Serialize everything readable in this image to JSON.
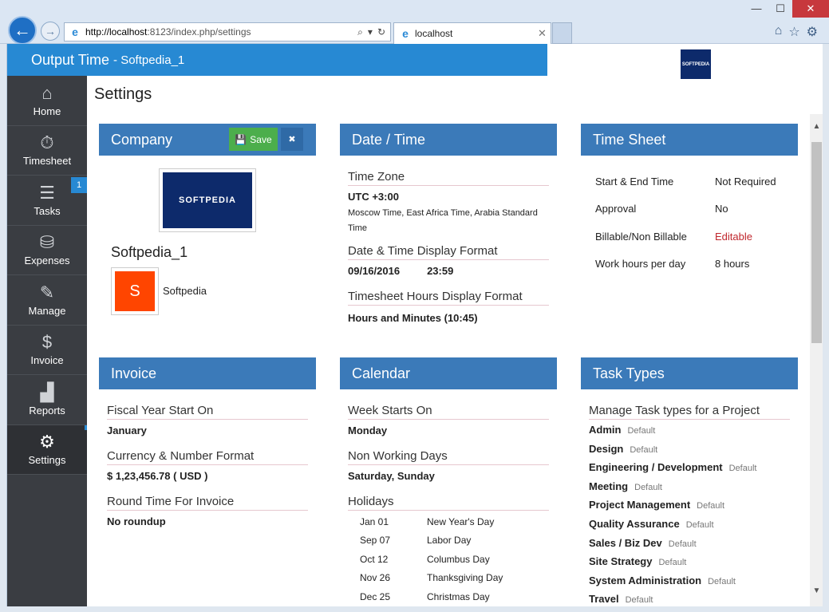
{
  "browser": {
    "url_host": "http://localhost",
    "url_rest": ":8123/index.php/settings",
    "tab_title": "localhost",
    "win_min": "—",
    "win_max": "☐",
    "win_close": "✕"
  },
  "app": {
    "title": "Output Time",
    "subtitle": "- Softpedia_1",
    "header_logo_text": "SOFTPEDIA"
  },
  "sidebar": {
    "items": [
      {
        "label": "Home",
        "icon": "home-icon"
      },
      {
        "label": "Timesheet",
        "icon": "stopwatch-icon"
      },
      {
        "label": "Tasks",
        "icon": "tasks-icon",
        "badge": "1"
      },
      {
        "label": "Expenses",
        "icon": "coins-icon"
      },
      {
        "label": "Manage",
        "icon": "edit-icon"
      },
      {
        "label": "Invoice",
        "icon": "invoice-icon"
      },
      {
        "label": "Reports",
        "icon": "chart-icon"
      },
      {
        "label": "Settings",
        "icon": "gear-icon"
      }
    ]
  },
  "page": {
    "title": "Settings"
  },
  "company": {
    "heading": "Company",
    "save_label": "Save",
    "logo_text": "SOFTPEDIA",
    "name": "Softpedia_1",
    "avatar_initial": "S",
    "avatar_label": "Softpedia"
  },
  "datetime": {
    "heading": "Date / Time",
    "tz_label": "Time Zone",
    "tz_value": "UTC +3:00",
    "tz_note": "Moscow Time, East Africa Time, Arabia Standard Time",
    "format_label": "Date & Time Display Format",
    "date_value": "09/16/2016",
    "time_value": "23:59",
    "hours_label": "Timesheet Hours Display Format",
    "hours_value": "Hours and Minutes (10:45)"
  },
  "timesheet": {
    "heading": "Time Sheet",
    "rows": [
      {
        "k": "Start & End Time",
        "v": "Not Required"
      },
      {
        "k": "Approval",
        "v": "No"
      },
      {
        "k": "Billable/Non Billable",
        "v": "Editable"
      },
      {
        "k": "Work hours per day",
        "v": "8 hours"
      }
    ]
  },
  "invoice": {
    "heading": "Invoice",
    "fiscal_label": "Fiscal Year Start On",
    "fiscal_value": "January",
    "currency_label": "Currency & Number Format",
    "currency_value": "$ 1,23,456.78 ( USD )",
    "round_label": "Round Time For Invoice",
    "round_value": "No roundup"
  },
  "calendar": {
    "heading": "Calendar",
    "week_label": "Week Starts On",
    "week_value": "Monday",
    "nonwork_label": "Non Working Days",
    "nonwork_value": "Saturday, Sunday",
    "holidays_label": "Holidays",
    "holidays": [
      {
        "d": "Jan 01",
        "n": "New Year's Day"
      },
      {
        "d": "Sep 07",
        "n": "Labor Day"
      },
      {
        "d": "Oct 12",
        "n": "Columbus Day"
      },
      {
        "d": "Nov 26",
        "n": "Thanksgiving Day"
      },
      {
        "d": "Dec 25",
        "n": "Christmas Day"
      }
    ]
  },
  "tasktypes": {
    "heading": "Task Types",
    "manage_label": "Manage Task types for a Project",
    "default_label": "Default",
    "items": [
      "Admin",
      "Design",
      "Engineering / Development",
      "Meeting",
      "Project Management",
      "Quality Assurance",
      "Sales / Biz Dev",
      "Site Strategy",
      "System Administration",
      "Travel"
    ]
  }
}
